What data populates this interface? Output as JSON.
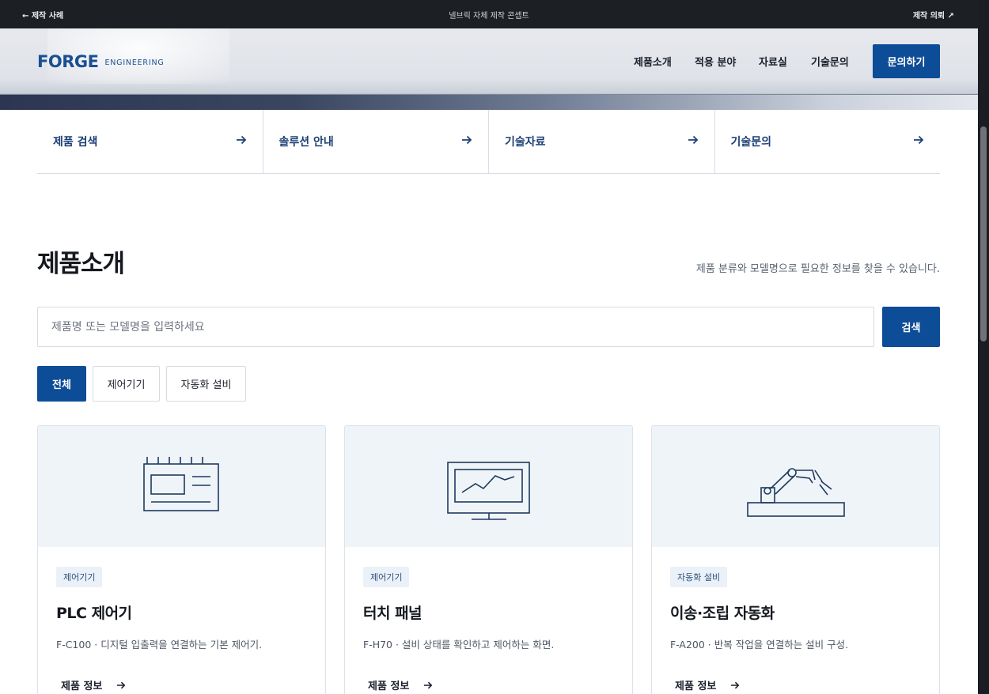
{
  "topbar": {
    "back_label": "← 제작 사례",
    "center_label": "넬브릭 자체 제작 콘셉트",
    "request_label": "제작 의뢰 ↗"
  },
  "header": {
    "logo_main": "FORGE",
    "logo_sub": "ENGINEERING",
    "nav": [
      "제품소개",
      "적용 분야",
      "자료실",
      "기술문의"
    ],
    "cta_label": "문의하기"
  },
  "quick_links": [
    {
      "label": "제품 검색",
      "icon": "arrow-right-icon"
    },
    {
      "label": "솔루션 안내",
      "icon": "arrow-right-icon"
    },
    {
      "label": "기술자료",
      "icon": "arrow-right-icon"
    },
    {
      "label": "기술문의",
      "icon": "arrow-right-icon"
    }
  ],
  "section": {
    "title": "제품소개",
    "description": "제품 분류와 모델명으로 필요한 정보를 찾을 수 있습니다."
  },
  "search": {
    "placeholder": "제품명 또는 모델명을 입력하세요",
    "value": "",
    "button_label": "검색"
  },
  "filters": [
    {
      "label": "전체",
      "selected": true
    },
    {
      "label": "제어기기",
      "selected": false
    },
    {
      "label": "자동화 설비",
      "selected": false
    }
  ],
  "products": [
    {
      "icon": "plc-controller-icon",
      "tag": "제어기기",
      "title": "PLC 제어기",
      "description": "F-C100 · 디지털 입출력을 연결하는 기본 제어기.",
      "link_label": "제품 정보"
    },
    {
      "icon": "touch-panel-monitor-icon",
      "tag": "제어기기",
      "title": "터치 패널",
      "description": "F-H70 · 설비 상태를 확인하고 제어하는 화면.",
      "link_label": "제품 정보"
    },
    {
      "icon": "robot-arm-icon",
      "tag": "자동화 설비",
      "title": "이송·조립 자동화",
      "description": "F-A200 · 반복 작업을 연결하는 설비 구성.",
      "link_label": "제품 정보"
    }
  ],
  "colors": {
    "brand": "#0d4c97",
    "topbar_bg": "#1c1f24",
    "card_thumb_bg": "#eff4f8",
    "icon_stroke": "#1f3a5f"
  }
}
